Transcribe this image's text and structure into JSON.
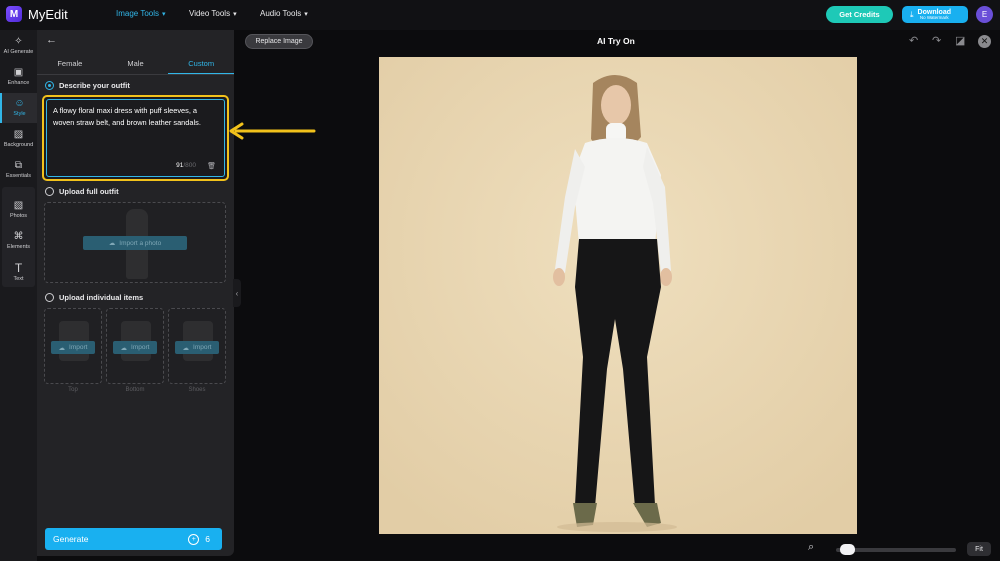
{
  "app": {
    "name": "MyEdit",
    "logo_letter": "M",
    "avatar_initial": "E"
  },
  "topnav": [
    {
      "label": "Image Tools"
    },
    {
      "label": "Video Tools"
    },
    {
      "label": "Audio Tools"
    }
  ],
  "header_actions": {
    "credits_label": "Get Credits",
    "download_label": "Download",
    "download_sub": "No Watermark"
  },
  "rail": [
    {
      "label": "AI Generate",
      "icon": "magic-wand-icon"
    },
    {
      "label": "Enhance",
      "icon": "image-enhance-icon"
    },
    {
      "label": "Style",
      "icon": "person-style-icon"
    },
    {
      "label": "Background",
      "icon": "background-icon"
    },
    {
      "label": "Essentials",
      "icon": "essentials-icon"
    },
    {
      "label": "Photos",
      "icon": "photos-icon"
    },
    {
      "label": "Elements",
      "icon": "elements-icon"
    },
    {
      "label": "Text",
      "icon": "text-icon"
    }
  ],
  "panel": {
    "tabs": [
      {
        "label": "Female"
      },
      {
        "label": "Male"
      },
      {
        "label": "Custom"
      }
    ],
    "describe_label": "Describe your outfit",
    "describe_text": "A flowy floral maxi dress with puff sleeves, a woven straw belt, and brown leather sandals.",
    "char_count": "91",
    "char_max": "/800",
    "full_outfit_label": "Upload full outfit",
    "import_photo_label": "Import a photo",
    "individual_label": "Upload individual items",
    "items": [
      {
        "import_label": "Import",
        "caption": "Top"
      },
      {
        "import_label": "Import",
        "caption": "Bottom"
      },
      {
        "import_label": "Import",
        "caption": "Shoes"
      }
    ],
    "generate_label": "Generate",
    "generate_cost": "6"
  },
  "canvas": {
    "replace_label": "Replace Image",
    "title": "AI Try On",
    "fit_label": "Fit",
    "zoom_level": 0.05
  },
  "colors": {
    "accent": "#31b6e8",
    "highlight": "#f2c21b",
    "credits": "#1ec9b7",
    "download": "#19b0f0",
    "photo_bg": "#e8d7b4"
  }
}
